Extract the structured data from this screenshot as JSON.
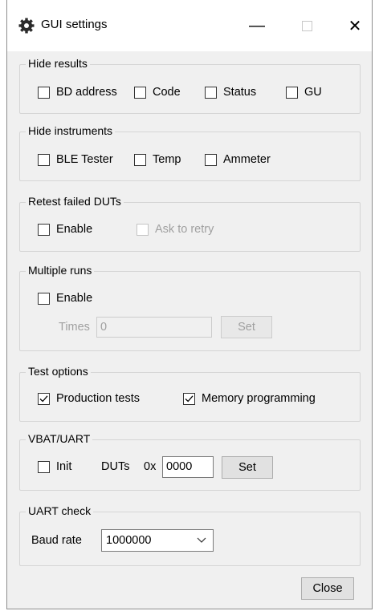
{
  "window": {
    "title": "GUI settings",
    "minimize_symbol": "—",
    "close_symbol": "✕"
  },
  "hide_results": {
    "legend": "Hide results",
    "items": [
      {
        "label": "BD address",
        "checked": false
      },
      {
        "label": "Code",
        "checked": false
      },
      {
        "label": "Status",
        "checked": false
      },
      {
        "label": "GU",
        "checked": false
      }
    ]
  },
  "hide_instruments": {
    "legend": "Hide instruments",
    "items": [
      {
        "label": "BLE Tester",
        "checked": false
      },
      {
        "label": "Temp",
        "checked": false
      },
      {
        "label": "Ammeter",
        "checked": false
      }
    ]
  },
  "retest": {
    "legend": "Retest failed DUTs",
    "enable_label": "Enable",
    "enable_checked": false,
    "ask_label": "Ask to retry",
    "ask_checked": false
  },
  "multiple_runs": {
    "legend": "Multiple runs",
    "enable_label": "Enable",
    "enable_checked": false,
    "times_label": "Times",
    "times_value": "0",
    "set_label": "Set"
  },
  "test_options": {
    "legend": "Test options",
    "production_label": "Production tests",
    "production_checked": true,
    "memory_label": "Memory programming",
    "memory_checked": true
  },
  "vbat_uart": {
    "legend": "VBAT/UART",
    "init_label": "Init",
    "init_checked": false,
    "duts_label": "DUTs",
    "hex_prefix": "0x",
    "duts_value": "0000",
    "set_label": "Set"
  },
  "uart_check": {
    "legend": "UART check",
    "baud_label": "Baud rate",
    "baud_value": "1000000"
  },
  "footer": {
    "close_label": "Close"
  }
}
